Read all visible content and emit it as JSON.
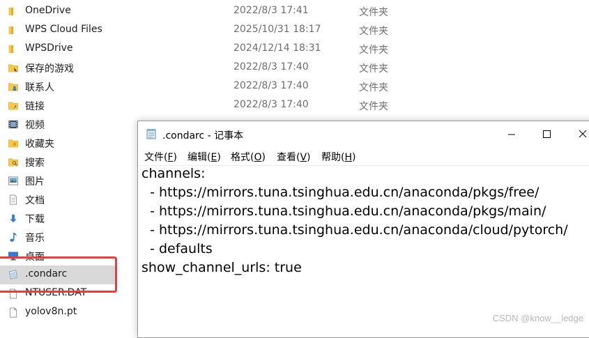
{
  "explorer": {
    "rows": [
      {
        "name": "OneDrive",
        "date": "2022/8/3 17:41",
        "type": "文件夹",
        "icon": "folder-icon"
      },
      {
        "name": "WPS Cloud Files",
        "date": "2025/10/31 18:17",
        "type": "文件夹",
        "icon": "folder-icon"
      },
      {
        "name": "WPSDrive",
        "date": "2024/12/14 18:31",
        "type": "文件夹",
        "icon": "folder-icon"
      },
      {
        "name": "保存的游戏",
        "date": "2022/8/3 17:40",
        "type": "文件夹",
        "icon": "saved-games-folder-icon"
      },
      {
        "name": "联系人",
        "date": "2022/8/3 17:40",
        "type": "文件夹",
        "icon": "contacts-folder-icon"
      },
      {
        "name": "链接",
        "date": "2022/8/3 17:40",
        "type": "文件夹",
        "icon": "links-folder-icon"
      },
      {
        "name": "视频",
        "date": "",
        "type": "",
        "icon": "videos-folder-icon"
      },
      {
        "name": "收藏夹",
        "date": "",
        "type": "",
        "icon": "favorites-folder-icon"
      },
      {
        "name": "搜索",
        "date": "",
        "type": "",
        "icon": "searches-folder-icon"
      },
      {
        "name": "图片",
        "date": "",
        "type": "",
        "icon": "pictures-folder-icon"
      },
      {
        "name": "文档",
        "date": "",
        "type": "",
        "icon": "documents-folder-icon"
      },
      {
        "name": "下载",
        "date": "",
        "type": "",
        "icon": "downloads-folder-icon"
      },
      {
        "name": "音乐",
        "date": "",
        "type": "",
        "icon": "music-folder-icon"
      },
      {
        "name": "桌面",
        "date": "",
        "type": "",
        "icon": "desktop-folder-icon"
      },
      {
        "name": ".condarc",
        "date": "",
        "type": "",
        "icon": "text-file-icon"
      },
      {
        "name": "NTUSER.DAT",
        "date": "",
        "type": "",
        "icon": "file-icon"
      },
      {
        "name": "yolov8n.pt",
        "date": "",
        "type": "",
        "icon": "file-icon"
      }
    ]
  },
  "notepad": {
    "title": ".condarc - 记事本",
    "menus": [
      {
        "label": "文件(",
        "key": "F",
        "tail": ")"
      },
      {
        "label": "编辑(",
        "key": "E",
        "tail": ")"
      },
      {
        "label": "格式(",
        "key": "O",
        "tail": ")"
      },
      {
        "label": "查看(",
        "key": "V",
        "tail": ")"
      },
      {
        "label": "帮助(",
        "key": "H",
        "tail": ")"
      }
    ],
    "content": "channels:\n  - https://mirrors.tuna.tsinghua.edu.cn/anaconda/pkgs/free/\n  - https://mirrors.tuna.tsinghua.edu.cn/anaconda/pkgs/main/\n  - https://mirrors.tuna.tsinghua.edu.cn/anaconda/cloud/pytorch/\n  - defaults\nshow_channel_urls: true"
  },
  "watermark": "CSDN @know__ledge",
  "colors": {
    "folder": "#f7c948",
    "highlight": "#ef3b3b",
    "selection": "#d9d9d9"
  }
}
